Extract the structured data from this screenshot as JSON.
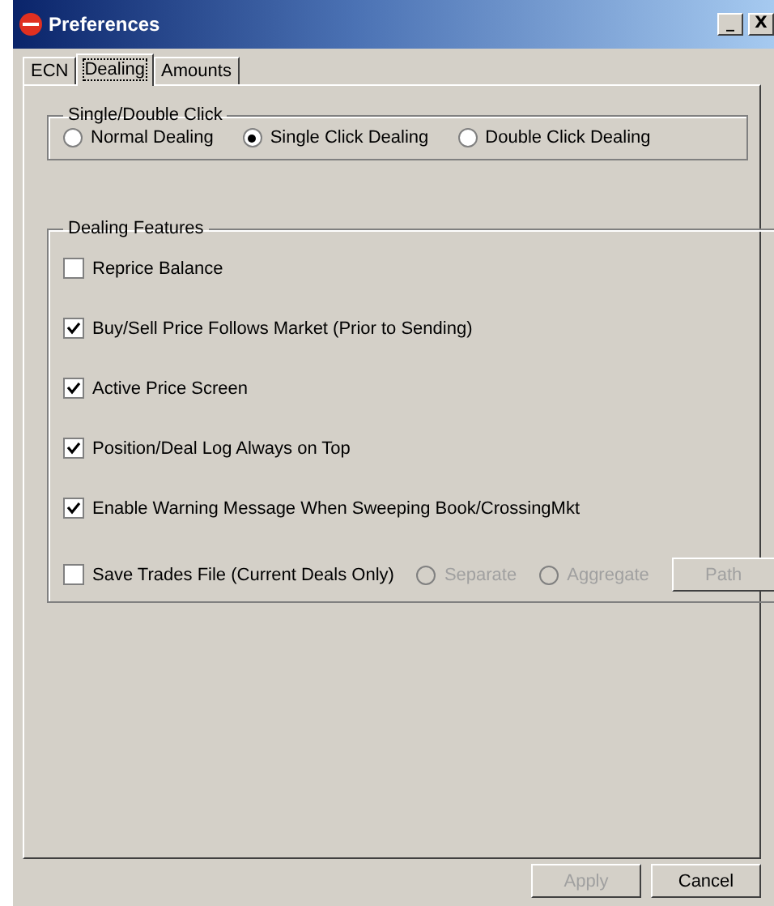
{
  "window": {
    "title": "Preferences",
    "controls": [
      "_",
      "X"
    ]
  },
  "tabs": [
    {
      "label": "ECN",
      "selected": false
    },
    {
      "label": "Dealing",
      "selected": true
    },
    {
      "label": "Amounts",
      "selected": false
    }
  ],
  "click_group": {
    "title": "Single/Double Click",
    "options": [
      {
        "label": "Normal Dealing",
        "selected": false
      },
      {
        "label": "Single Click Dealing",
        "selected": true
      },
      {
        "label": "Double Click Dealing",
        "selected": false
      }
    ]
  },
  "features_group": {
    "title": "Dealing Features",
    "items": [
      {
        "label": "Reprice Balance",
        "checked": false
      },
      {
        "label": "Buy/Sell Price Follows Market (Prior to Sending)",
        "checked": true
      },
      {
        "label": "Active Price Screen",
        "checked": true
      },
      {
        "label": "Position/Deal Log Always on Top",
        "checked": true
      },
      {
        "label": "Enable Warning Message When Sweeping Book/CrossingMkt",
        "checked": true
      },
      {
        "label": "Save Trades File (Current Deals Only)",
        "checked": false
      }
    ],
    "save_options": [
      {
        "label": "Separate",
        "selected": false,
        "disabled": true
      },
      {
        "label": "Aggregate",
        "selected": false,
        "disabled": true
      }
    ],
    "path_button": {
      "label": "Path",
      "disabled": true
    }
  },
  "buttons": [
    {
      "label": "Apply",
      "disabled": true
    },
    {
      "label": "Cancel",
      "disabled": false
    }
  ]
}
